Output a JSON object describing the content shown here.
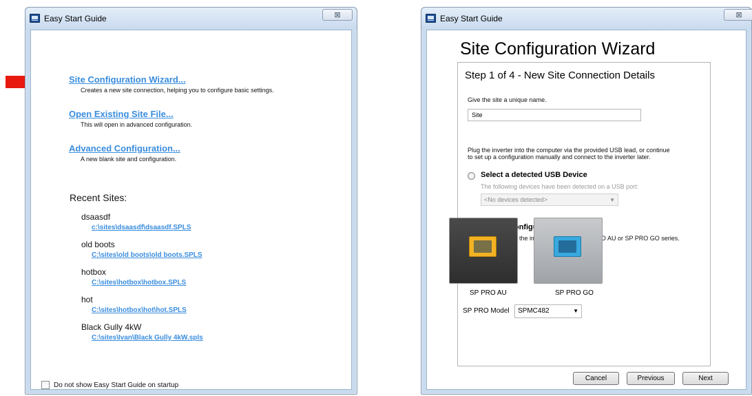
{
  "left_window": {
    "title": "Easy Start Guide",
    "close_glyph": "⊠",
    "menu": [
      {
        "label": "Site Configuration Wizard...",
        "description": "Creates a new site connection, helping you to configure basic settings."
      },
      {
        "label": "Open Existing Site File...",
        "description": "This will open in advanced configuration."
      },
      {
        "label": "Advanced Configuration...",
        "description": "A new blank site and configuration."
      }
    ],
    "recent_heading": "Recent Sites:",
    "recent_sites": [
      {
        "name": "dsaasdf",
        "path": "c:\\sites\\dsaasdf\\dsaasdf.SPLS"
      },
      {
        "name": "old boots",
        "path": "C:\\sites\\old boots\\old boots.SPLS"
      },
      {
        "name": "hotbox",
        "path": "C:\\sites\\hotbox\\hotbox.SPLS"
      },
      {
        "name": "hot",
        "path": "C:\\sites\\hotbox\\hot\\hot.SPLS"
      },
      {
        "name": "Black Gully 4kW",
        "path": "C:\\sites\\Ivan\\Black Gully 4kW.spls"
      }
    ],
    "startup_checkbox_label": "Do not show Easy Start Guide on startup",
    "startup_checked": false
  },
  "right_window": {
    "title": "Easy Start Guide",
    "close_glyph": "⊠",
    "wizard_title": "Site Configuration Wizard",
    "step_title": "Step 1 of 4 - New Site Connection Details",
    "name_prompt": "Give the site a unique name.",
    "site_name_value": "Site",
    "plug_instructions_line1": "Plug the inverter into the computer via the provided USB lead, or continue",
    "plug_instructions_line2": "to set up a configuration manually and connect to the inverter later.",
    "usb_option": {
      "label": "Select a detected USB Device",
      "selected": false,
      "hint": "The following devices have been detected on a USB port:",
      "dropdown_value": "<No devices detected>"
    },
    "manual_option": {
      "label": "Manual Configuration",
      "selected": true,
      "hint": "Please select the image of either the SP PRO AU or SP PRO GO series."
    },
    "models": [
      {
        "caption": "SP PRO AU",
        "panel_color": "#f2b224"
      },
      {
        "caption": "SP PRO GO",
        "panel_color": "#38a9de"
      }
    ],
    "model_label": "SP PRO Model",
    "model_value": "SPMC482",
    "buttons": {
      "cancel": "Cancel",
      "previous": "Previous",
      "next": "Next"
    }
  },
  "colors": {
    "link": "#3a8dde",
    "arrow": "#e8190f",
    "radio_selected": "#2a6ec1"
  }
}
